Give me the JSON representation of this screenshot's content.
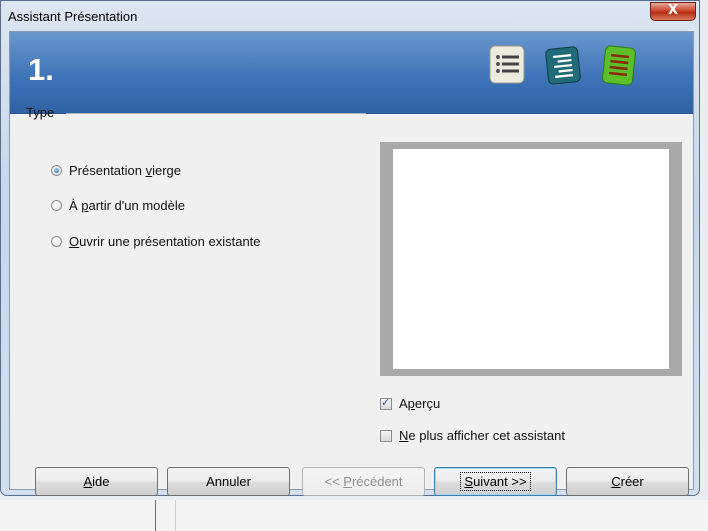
{
  "window": {
    "title": "Assistant Présentation",
    "close_label": "X"
  },
  "header": {
    "step": "1."
  },
  "type_group": {
    "label": "Type",
    "options": [
      {
        "before": "Présentation ",
        "mnemonic": "v",
        "after": "ierge",
        "selected": true
      },
      {
        "before": "À ",
        "mnemonic": "p",
        "after": "artir d'un modèle",
        "selected": false
      },
      {
        "before": "",
        "mnemonic": "O",
        "after": "uvrir une présentation existante",
        "selected": false
      }
    ]
  },
  "checks": {
    "preview": {
      "before": "A",
      "mnemonic": "p",
      "after": "erçu",
      "checked": true
    },
    "no_show": {
      "before": "",
      "mnemonic": "N",
      "after": "e plus afficher cet assistant",
      "checked": false
    }
  },
  "buttons": {
    "help": {
      "before": "",
      "mnemonic": "A",
      "after": "ide"
    },
    "cancel": {
      "label": "Annuler"
    },
    "previous": {
      "before": "<< ",
      "mnemonic": "P",
      "after": "récédent",
      "enabled": false
    },
    "next": {
      "before": "",
      "mnemonic": "S",
      "after": "uivant >>"
    },
    "create": {
      "before": "",
      "mnemonic": "C",
      "after": "réer"
    }
  },
  "colors": {
    "banner": "#3e74b8",
    "accent": "#1c5fb8"
  }
}
